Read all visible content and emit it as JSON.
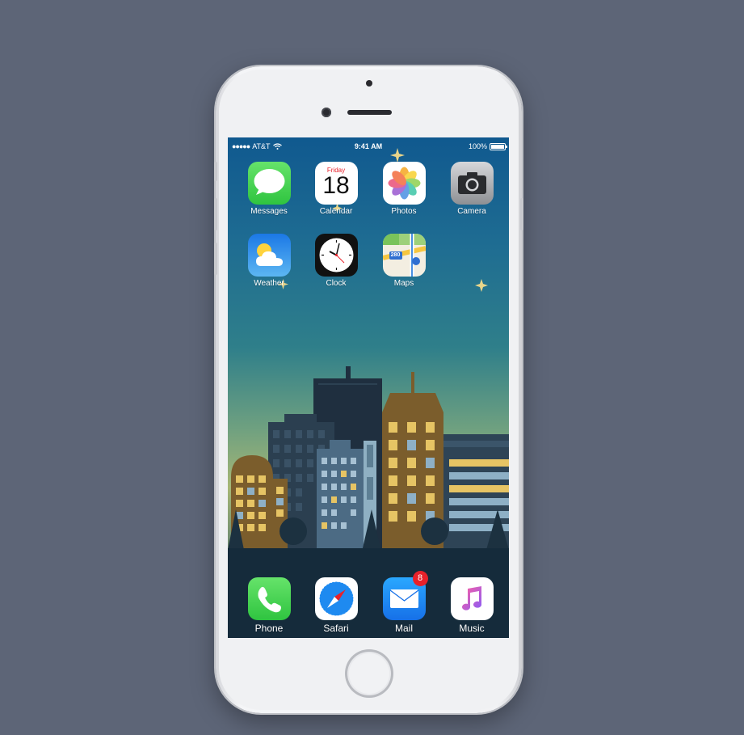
{
  "status_bar": {
    "carrier": "AT&T",
    "time": "9:41 AM",
    "battery": "100%"
  },
  "home_apps": [
    {
      "label": "Messages"
    },
    {
      "label": "Calendar",
      "weekday": "Friday",
      "day": "18"
    },
    {
      "label": "Photos"
    },
    {
      "label": "Camera"
    },
    {
      "label": "Weather"
    },
    {
      "label": "Clock"
    },
    {
      "label": "Maps",
      "route": "280"
    }
  ],
  "dock_apps": [
    {
      "label": "Phone"
    },
    {
      "label": "Safari"
    },
    {
      "label": "Mail",
      "badge": "8"
    },
    {
      "label": "Music"
    }
  ],
  "colors": {
    "background": "#5d6577",
    "badge": "#e8212a",
    "messages_green": "#35c94a",
    "mail_blue": "#1e8af0"
  }
}
